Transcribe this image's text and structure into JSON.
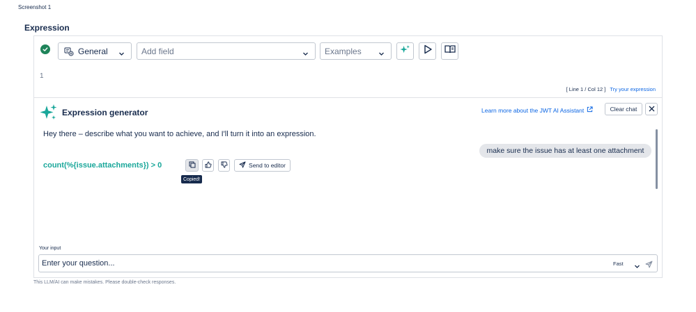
{
  "screenshot_label": "Screenshot 1",
  "section_title": "Expression",
  "toolbar": {
    "context_select": "General",
    "add_field_placeholder": "Add field",
    "examples_placeholder": "Examples"
  },
  "editor": {
    "line_number": "1",
    "status": "[ Line 1 / Col 12 ]",
    "try_link": "Try your expression"
  },
  "generator": {
    "title": "Expression generator",
    "learn_more": "Learn more about the JWT AI Assistant",
    "clear_chat": "Clear chat",
    "greeting": "Hey there – describe what you want to achieve, and I'll turn it into an expression.",
    "user_message": "make sure the issue has at least one attachment",
    "expression": "count(%{issue.attachments}) > 0",
    "send_to_editor": "Send to editor",
    "tooltip": "Copied!"
  },
  "input": {
    "label": "Your input",
    "placeholder": "Enter your question...",
    "mode": "Fast"
  },
  "disclaimer": "This LLM/AI can make mistakes. Please double-check responses.",
  "colors": {
    "accent_teal": "#1aa79a",
    "success_green": "#1f845a",
    "link_blue": "#0c66e4"
  }
}
